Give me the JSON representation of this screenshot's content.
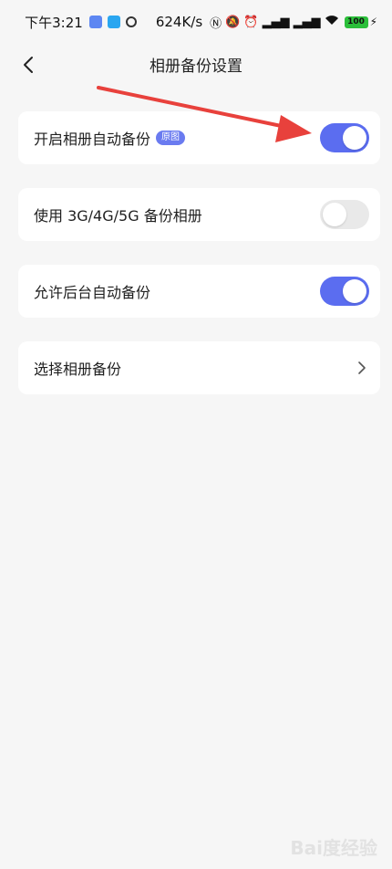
{
  "status_bar": {
    "time": "下午3:21",
    "net_speed": "624K/s",
    "battery": "100"
  },
  "header": {
    "title": "相册备份设置"
  },
  "settings": [
    {
      "label": "开启相册自动备份",
      "badge": "原图",
      "toggle": "on"
    },
    {
      "label": "使用 3G/4G/5G 备份相册",
      "toggle": "off"
    },
    {
      "label": "允许后台自动备份",
      "toggle": "on"
    },
    {
      "label": "选择相册备份"
    }
  ],
  "colors": {
    "accent": "#5b6df0",
    "annotation_arrow": "#e8413c",
    "background": "#f6f6f6"
  },
  "watermark": "Bai度经验"
}
